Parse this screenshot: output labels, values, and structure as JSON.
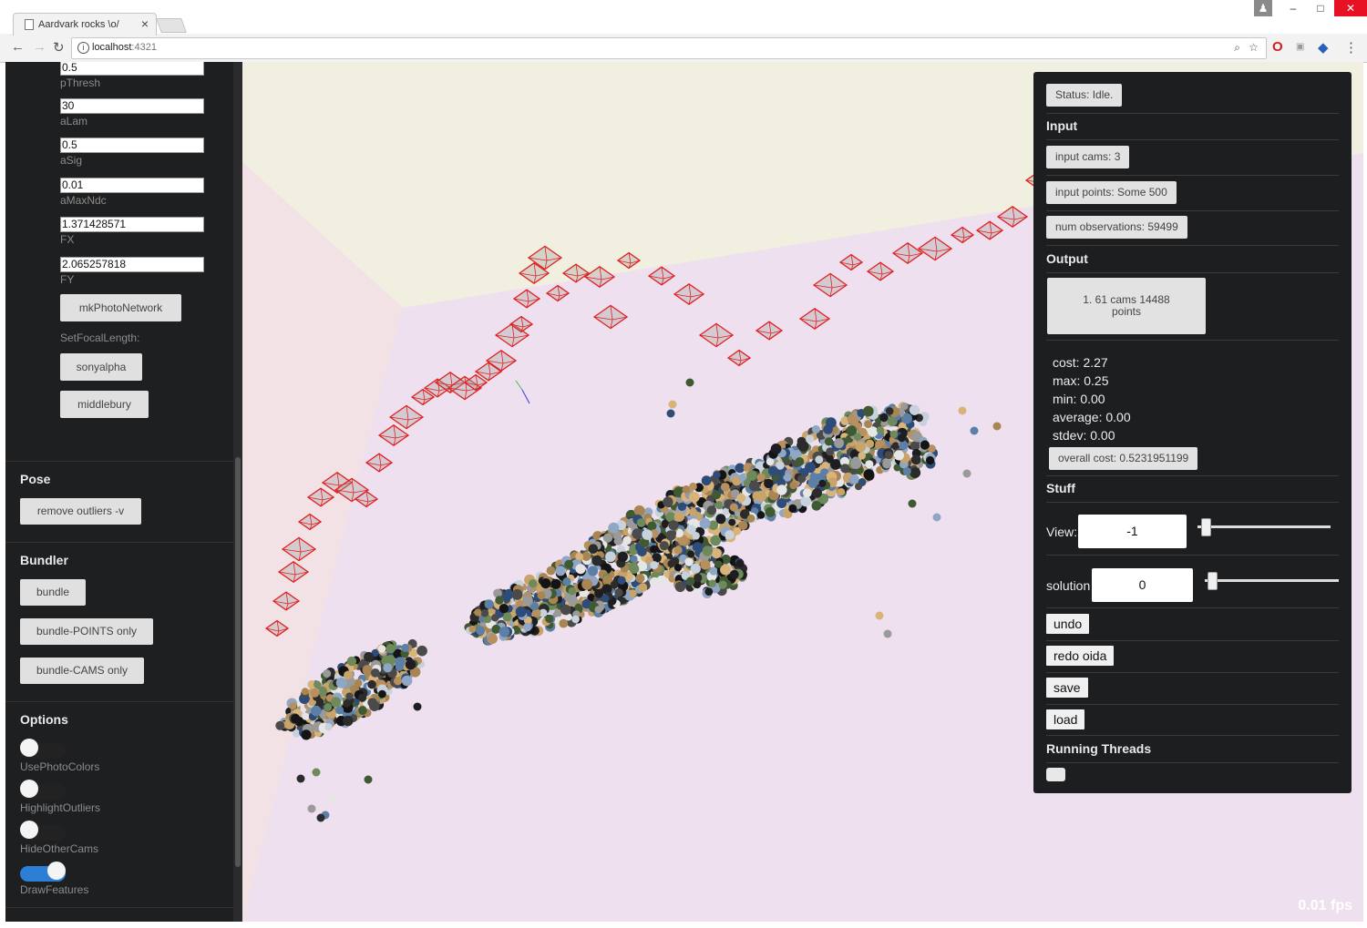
{
  "browser": {
    "tab_title": "Aardvark rocks \\o/",
    "url_host": "localhost",
    "url_port": ":4321",
    "info_icon": "info-icon"
  },
  "left_panel": {
    "params": [
      {
        "value": "0.5",
        "label": "pThresh"
      },
      {
        "value": "30",
        "label": "aLam"
      },
      {
        "value": "0.5",
        "label": "aSig"
      },
      {
        "value": "0.01",
        "label": "aMaxNdc"
      },
      {
        "value": "1.371428571",
        "label": "FX"
      },
      {
        "value": "2.065257818",
        "label": "FY"
      }
    ],
    "mk_photo_network": "mkPhotoNetwork",
    "set_focal_length_label": "SetFocalLength:",
    "sonyalpha": "sonyalpha",
    "middlebury": "middlebury",
    "pose_header": "Pose",
    "remove_outliers": "remove outliers -v",
    "bundler_header": "Bundler",
    "bundle": "bundle",
    "bundle_points_only": "bundle-POINTS only",
    "bundle_cams_only": "bundle-CAMS only",
    "options_header": "Options",
    "options": [
      {
        "label": "UsePhotoColors",
        "on": false
      },
      {
        "label": "HighlightOutliers",
        "on": false
      },
      {
        "label": "HideOtherCams",
        "on": false
      },
      {
        "label": "DrawFeatures",
        "on": true
      }
    ],
    "toggle_on_color": "#2d7fd6"
  },
  "right_panel": {
    "status": "Status: Idle.",
    "input_header": "Input",
    "input_cams": "input cams: 3",
    "input_points": "input points: Some 500",
    "num_observations": "num observations: 59499",
    "output_header": "Output",
    "output_item": "1. 61 cams 14488 points",
    "stats": {
      "cost": "cost: 2.27",
      "max": "max: 0.25",
      "min": "min: 0.00",
      "average": "average: 0.00",
      "stdev": "stdev: 0.00"
    },
    "overall_cost": "overall cost: 0.5231951199",
    "stuff_header": "Stuff",
    "view_label": "View:",
    "view_value": "-1",
    "solution_label": "solution",
    "solution_value": "0",
    "undo": "undo",
    "redo": "redo oida",
    "save": "save",
    "load": "load",
    "running_threads_header": "Running Threads"
  },
  "viewport": {
    "fps": "0.01 fps",
    "camera_frustum_color": "#e02020",
    "wall_colors": {
      "top": "#f0f0e0",
      "left": "#f2e0e6",
      "floor": "#efe0ef"
    }
  }
}
